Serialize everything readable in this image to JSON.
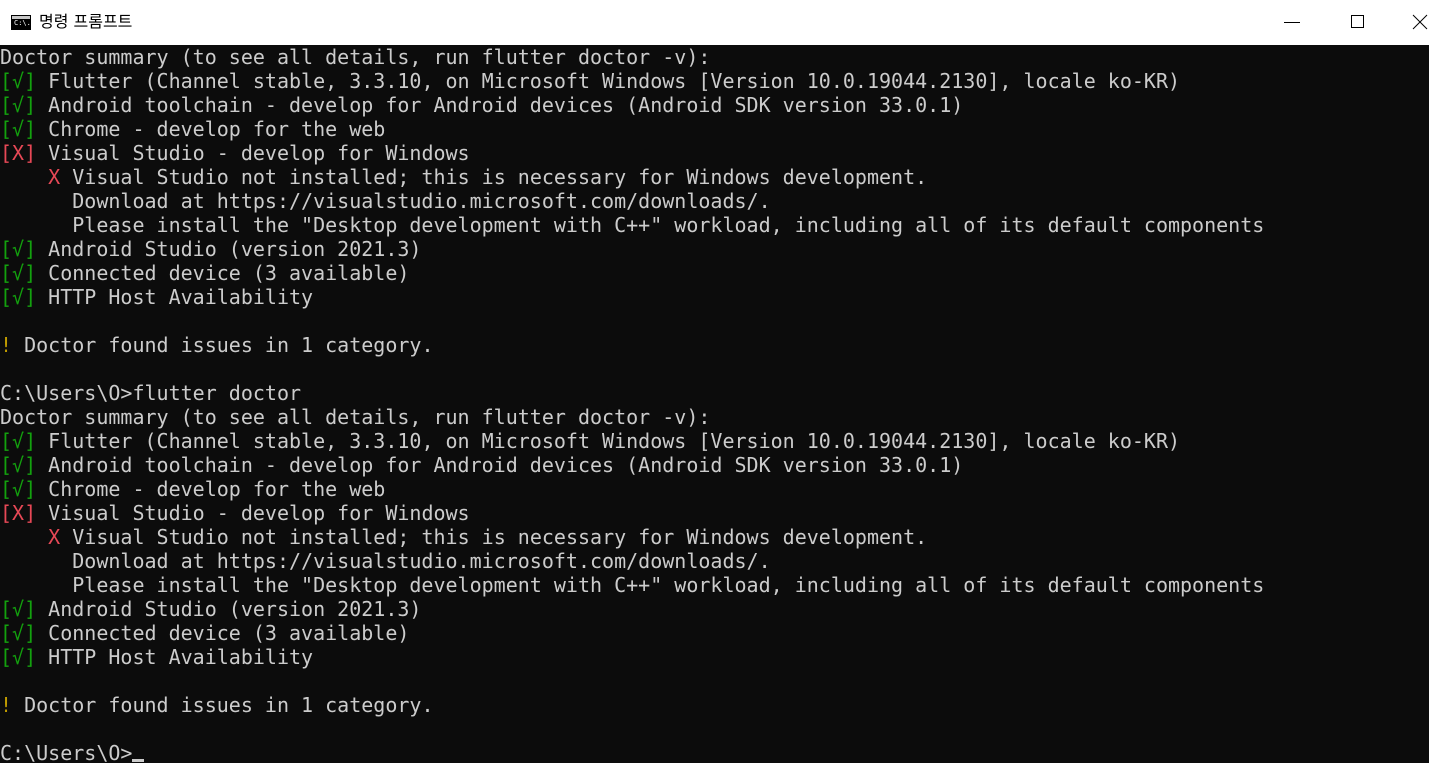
{
  "window": {
    "title": "명령 프롬프트",
    "icon": "cmd-icon",
    "icon_text": "C:\\.",
    "controls": [
      "minimize-icon",
      "maximize-icon",
      "close-icon"
    ]
  },
  "colors": {
    "background": "#0c0c0c",
    "text": "#cccccc",
    "ok": "#13a10e",
    "error": "#e74856",
    "warning": "#c19c00"
  },
  "console": {
    "lines": [
      {
        "prefix": "",
        "text": "Doctor summary (to see all details, run flutter doctor -v):"
      },
      {
        "prefix": "[√]",
        "type": "ok",
        "text": " Flutter (Channel stable, 3.3.10, on Microsoft Windows [Version 10.0.19044.2130], locale ko-KR)"
      },
      {
        "prefix": "[√]",
        "type": "ok",
        "text": " Android toolchain - develop for Android devices (Android SDK version 33.0.1)"
      },
      {
        "prefix": "[√]",
        "type": "ok",
        "text": " Chrome - develop for the web"
      },
      {
        "prefix": "[X]",
        "type": "error",
        "text": " Visual Studio - develop for Windows"
      },
      {
        "indent": "    ",
        "prefix": "X",
        "type": "error",
        "text": " Visual Studio not installed; this is necessary for Windows development."
      },
      {
        "prefix": "",
        "text": "      Download at https://visualstudio.microsoft.com/downloads/."
      },
      {
        "prefix": "",
        "text": "      Please install the \"Desktop development with C++\" workload, including all of its default components"
      },
      {
        "prefix": "[√]",
        "type": "ok",
        "text": " Android Studio (version 2021.3)"
      },
      {
        "prefix": "[√]",
        "type": "ok",
        "text": " Connected device (3 available)"
      },
      {
        "prefix": "[√]",
        "type": "ok",
        "text": " HTTP Host Availability"
      },
      {
        "prefix": "",
        "text": ""
      },
      {
        "prefix": "!",
        "type": "warn",
        "text": " Doctor found issues in 1 category."
      },
      {
        "prefix": "",
        "text": ""
      },
      {
        "prefix": "",
        "text": "C:\\Users\\O>flutter doctor"
      },
      {
        "prefix": "",
        "text": "Doctor summary (to see all details, run flutter doctor -v):"
      },
      {
        "prefix": "[√]",
        "type": "ok",
        "text": " Flutter (Channel stable, 3.3.10, on Microsoft Windows [Version 10.0.19044.2130], locale ko-KR)"
      },
      {
        "prefix": "[√]",
        "type": "ok",
        "text": " Android toolchain - develop for Android devices (Android SDK version 33.0.1)"
      },
      {
        "prefix": "[√]",
        "type": "ok",
        "text": " Chrome - develop for the web"
      },
      {
        "prefix": "[X]",
        "type": "error",
        "text": " Visual Studio - develop for Windows"
      },
      {
        "indent": "    ",
        "prefix": "X",
        "type": "error",
        "text": " Visual Studio not installed; this is necessary for Windows development."
      },
      {
        "prefix": "",
        "text": "      Download at https://visualstudio.microsoft.com/downloads/."
      },
      {
        "prefix": "",
        "text": "      Please install the \"Desktop development with C++\" workload, including all of its default components"
      },
      {
        "prefix": "[√]",
        "type": "ok",
        "text": " Android Studio (version 2021.3)"
      },
      {
        "prefix": "[√]",
        "type": "ok",
        "text": " Connected device (3 available)"
      },
      {
        "prefix": "[√]",
        "type": "ok",
        "text": " HTTP Host Availability"
      },
      {
        "prefix": "",
        "text": ""
      },
      {
        "prefix": "!",
        "type": "warn",
        "text": " Doctor found issues in 1 category."
      },
      {
        "prefix": "",
        "text": ""
      }
    ],
    "prompt": "C:\\Users\\O>"
  }
}
